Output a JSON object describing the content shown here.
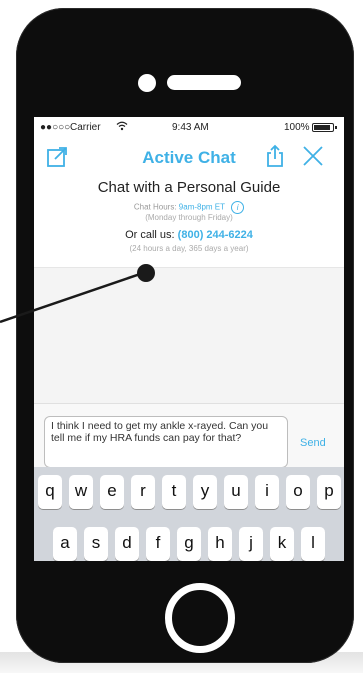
{
  "status_bar": {
    "signal": "●●○○○",
    "carrier": "Carrier",
    "time": "9:43 AM",
    "battery": "100%"
  },
  "nav": {
    "title": "Active Chat",
    "icons": [
      "compose-icon",
      "share-icon",
      "close-icon"
    ]
  },
  "header": {
    "title": "Chat with a Personal Guide",
    "hours_label": "Chat Hours:",
    "hours_value": "9am-8pm ET",
    "days": "(Monday through Friday)",
    "call_label": "Or call us:",
    "call_number": "(800) 244-6224",
    "call_hours": "(24 hours a day, 365 days a year)"
  },
  "composer": {
    "message": "I think I need to get my ankle x-rayed. Can you tell me if my HRA funds can pay for that?",
    "send_label": "Send"
  },
  "keyboard": {
    "row1": [
      "q",
      "w",
      "e",
      "r",
      "t",
      "y",
      "u",
      "i",
      "o",
      "p"
    ],
    "row2": [
      "a",
      "s",
      "d",
      "f",
      "g",
      "h",
      "j",
      "k",
      "l"
    ]
  },
  "colors": {
    "accent": "#3fb1e6",
    "phone_body": "#0d0d0d"
  }
}
